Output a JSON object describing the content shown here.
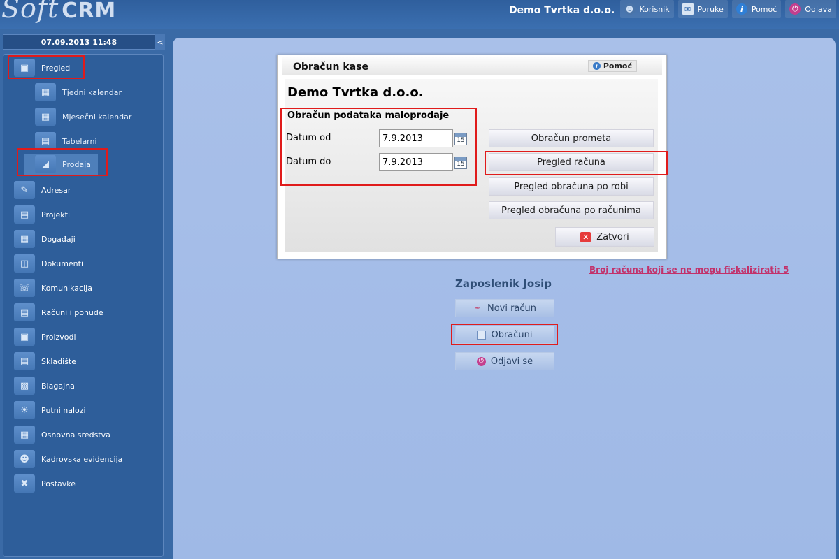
{
  "header": {
    "logo_soft": "Soft",
    "logo_crm": "CRM",
    "company": "Demo Tvrtka d.o.o.",
    "nav": [
      {
        "label": "Korisnik",
        "icon": "user-icon"
      },
      {
        "label": "Poruke",
        "icon": "mail-icon"
      },
      {
        "label": "Pomoć",
        "icon": "info-icon"
      },
      {
        "label": "Odjava",
        "icon": "power-icon"
      }
    ]
  },
  "sidebar": {
    "datetime": "07.09.2013 11:48",
    "collapse": "<",
    "items": [
      {
        "label": "Pregled",
        "icon": "overview-icon"
      },
      {
        "label": "Tjedni kalendar",
        "icon": "calendar-week-icon"
      },
      {
        "label": "Mjesečni kalendar",
        "icon": "calendar-month-icon"
      },
      {
        "label": "Tabelarni",
        "icon": "table-icon"
      },
      {
        "label": "Prodaja",
        "icon": "sales-icon"
      },
      {
        "label": "Adresar",
        "icon": "address-book-icon"
      },
      {
        "label": "Projekti",
        "icon": "projects-icon"
      },
      {
        "label": "Događaji",
        "icon": "events-icon"
      },
      {
        "label": "Dokumenti",
        "icon": "documents-icon"
      },
      {
        "label": "Komunikacija",
        "icon": "communication-icon"
      },
      {
        "label": "Računi i ponude",
        "icon": "invoices-icon"
      },
      {
        "label": "Proizvodi",
        "icon": "products-icon"
      },
      {
        "label": "Skladište",
        "icon": "warehouse-icon"
      },
      {
        "label": "Blagajna",
        "icon": "cashbox-icon"
      },
      {
        "label": "Putni nalozi",
        "icon": "travel-orders-icon"
      },
      {
        "label": "Osnovna sredstva",
        "icon": "fixed-assets-icon"
      },
      {
        "label": "Kadrovska evidencija",
        "icon": "hr-icon"
      },
      {
        "label": "Postavke",
        "icon": "settings-icon"
      }
    ]
  },
  "dialog": {
    "title": "Obračun kase",
    "help": "Pomoć",
    "company": "Demo Tvrtka d.o.o.",
    "section": "Obračun podataka maloprodaje",
    "date_from_label": "Datum od",
    "date_from": "7.9.2013",
    "date_to_label": "Datum do",
    "date_to": "7.9.2013",
    "calendar_day": "15",
    "buttons": [
      "Obračun prometa",
      "Pregled računa",
      "Pregled obračuna po robi",
      "Pregled obračuna po računima"
    ],
    "close": "Zatvori"
  },
  "main": {
    "fiscal_link": "Broj računa koji se ne mogu fiskalizirati: 5",
    "employee": "Zaposlenik Josip",
    "new_invoice": "Novi račun",
    "settlements": "Obračuni",
    "logout": "Odjavi se"
  },
  "colors": {
    "highlight": "#e01b1b",
    "link": "#c2316a",
    "header_bg": "#2f5f9d",
    "content_bg": "#a9c0e9"
  }
}
